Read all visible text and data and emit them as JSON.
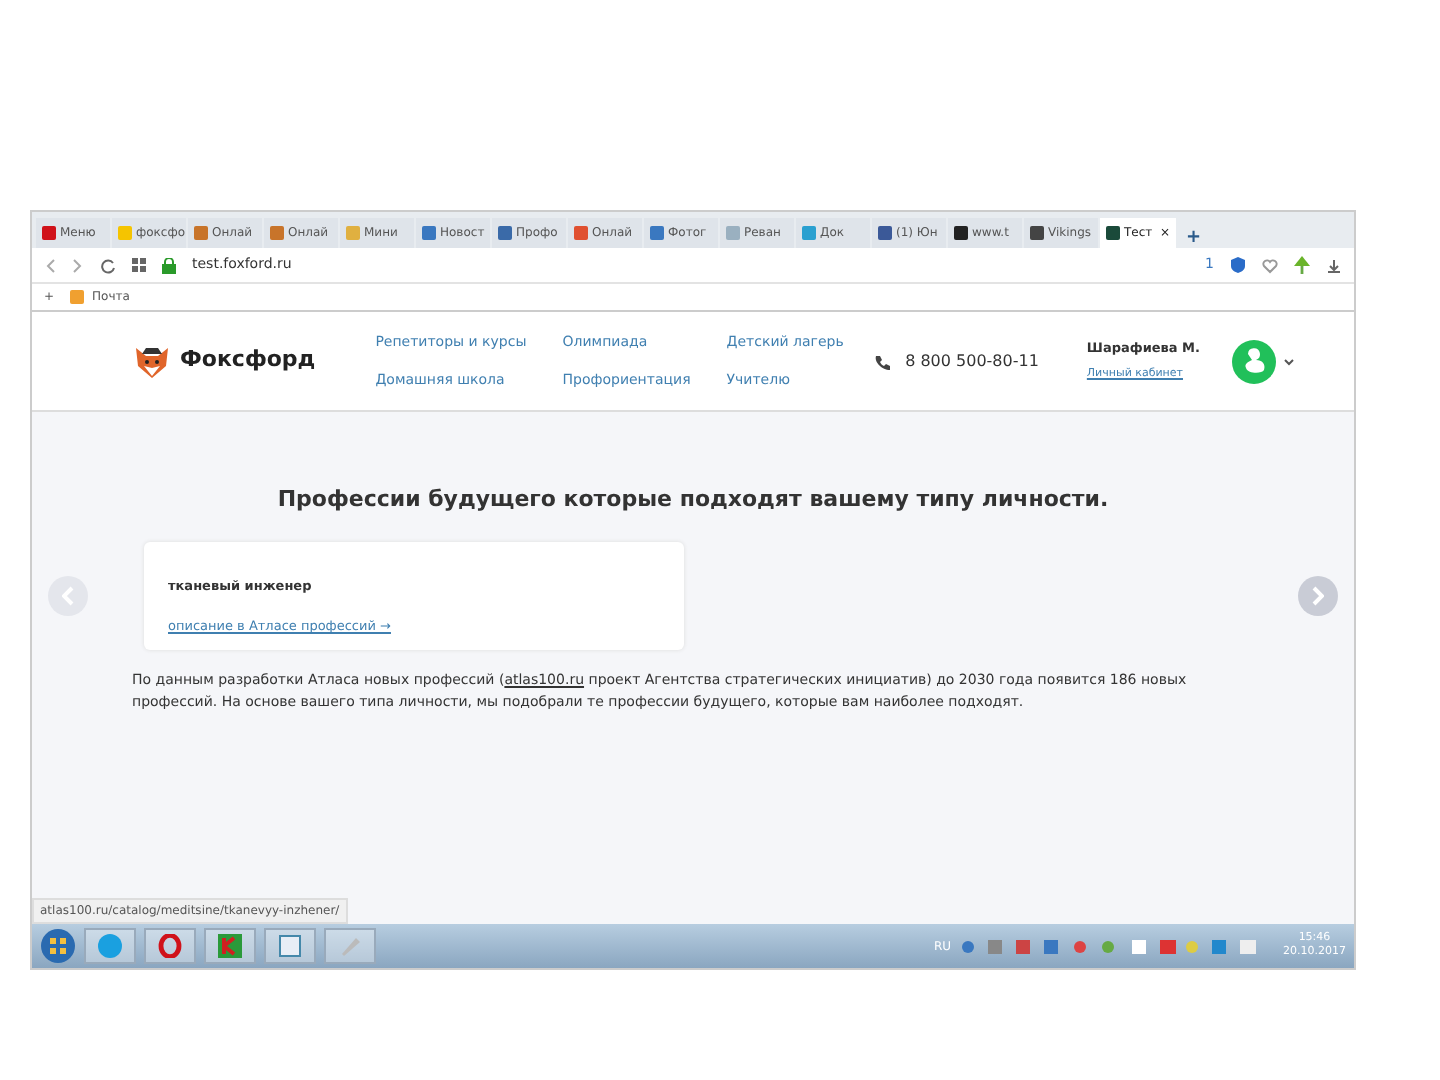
{
  "browser": {
    "tabs": [
      {
        "label": "Меню",
        "selected": false,
        "color": "#d0121a"
      },
      {
        "label": "фоксфо",
        "selected": false,
        "color": "#f5c400"
      },
      {
        "label": "Онлай",
        "selected": false,
        "color": "#c8742a"
      },
      {
        "label": "Онлай",
        "selected": false,
        "color": "#c8742a"
      },
      {
        "label": "Мини",
        "selected": false,
        "color": "#e0b040"
      },
      {
        "label": "Новост",
        "selected": false,
        "color": "#3a78c0"
      },
      {
        "label": "Профо",
        "selected": false,
        "color": "#3a6aa8"
      },
      {
        "label": "Онлай",
        "selected": false,
        "color": "#e05030"
      },
      {
        "label": "Фотог",
        "selected": false,
        "color": "#3a78c0"
      },
      {
        "label": "Реван",
        "selected": false,
        "color": "#9ab0c0"
      },
      {
        "label": "Док",
        "selected": false,
        "color": "#2aa0d0"
      },
      {
        "label": "(1) Юн",
        "selected": false,
        "color": "#3b5998"
      },
      {
        "label": "www.t",
        "selected": false,
        "color": "#222222"
      },
      {
        "label": "Vikings",
        "selected": false,
        "color": "#444444"
      },
      {
        "label": "Тест",
        "selected": true,
        "color": "#1a4a3a"
      }
    ],
    "tab_close": "×",
    "new_tab": "+",
    "address": {
      "url": "test.foxford.ru"
    },
    "adblock_count": "1",
    "bookmarks_add": "+",
    "bookmarks": [
      {
        "label": "Почта"
      }
    ]
  },
  "site": {
    "logo": "Фоксфорд",
    "nav": [
      [
        "Репетиторы и курсы",
        "Олимпиада",
        "Детский лагерь"
      ],
      [
        "Домашняя школа",
        "Профориентация",
        "Учителю"
      ]
    ],
    "phone": "8 800 500-80-11",
    "user_name": "Шарафиева М.",
    "account_link": "Личный кабинет"
  },
  "heading": "Профессии будущего которые подходят вашему типу личности.",
  "cards": [
    {
      "title": "тканевый инженер",
      "link": "описание в Атласе профессий →"
    }
  ],
  "intro": {
    "before": "По данным разработки Атласа новых профессий (",
    "link": "atlas100.ru",
    "after": " проект Агентства стратегических инициатив) до 2030 года появится 186 новых профессий. На основе вашего типа личности, мы подобрали те профессии будущего, которые вам наиболее подходят."
  },
  "status_url": "atlas100.ru/catalog/meditsine/tkanevyy-inzhener/",
  "taskbar": {
    "language": "RU",
    "time": "15:46",
    "date": "20.10.2017"
  }
}
